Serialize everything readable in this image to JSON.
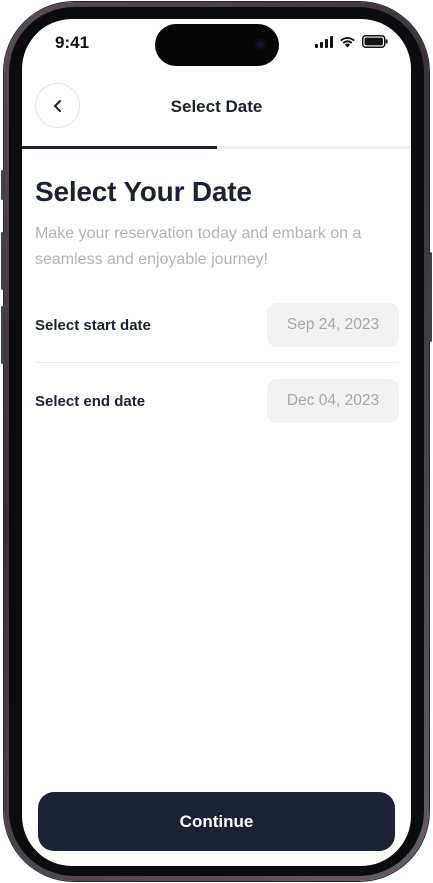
{
  "status_bar": {
    "time": "9:41"
  },
  "nav": {
    "title": "Select Date",
    "back_icon": "chevron-left-icon"
  },
  "progress": {
    "fraction": 0.5
  },
  "content": {
    "heading": "Select Your Date",
    "subtitle": "Make your reservation today and embark on a seamless and enjoyable journey!"
  },
  "start_date": {
    "label": "Select start date",
    "value": "Sep 24, 2023"
  },
  "end_date": {
    "label": "Select end date",
    "value": "Dec 04, 2023"
  },
  "footer": {
    "continue_label": "Continue"
  },
  "colors": {
    "primary": "#1b2233",
    "muted_text": "#b0b2b7",
    "pill_background": "#f2f2f3"
  }
}
